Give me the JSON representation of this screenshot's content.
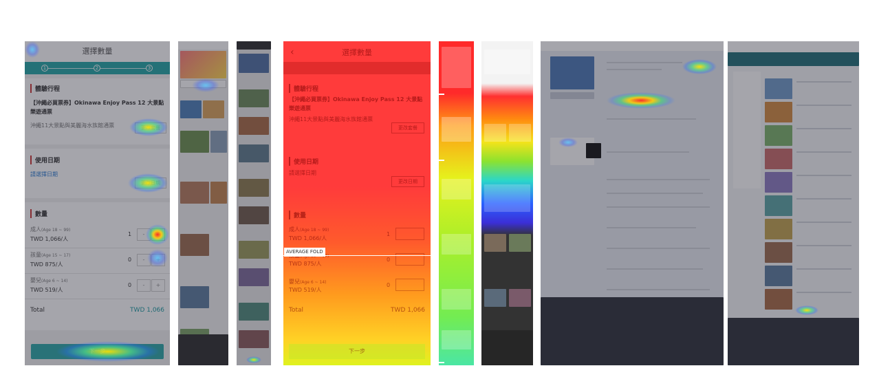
{
  "fold_label": "AVERAGE FOLD",
  "checkout": {
    "header_title": "選擇數量",
    "steps": [
      "1",
      "2",
      "3"
    ],
    "experience": {
      "section_title": "體驗行程",
      "product_name": "【沖繩必買票券】Okinawa Enjoy Pass 12 大景點樂遊通票",
      "plan_name": "沖繩11大景點與美麗海水族館通票",
      "change_button": "更改套餐"
    },
    "date": {
      "section_title": "使用日期",
      "placeholder": "請選擇日期",
      "change_button": "更改日期"
    },
    "quantity": {
      "section_title": "數量",
      "rows": [
        {
          "label": "成人",
          "age": "(Age 18 ~ 99)",
          "price": "TWD 1,066/人",
          "qty": "1",
          "minus": "-",
          "plus": "+"
        },
        {
          "label": "孩童",
          "age": "(Age 15 ~ 17)",
          "price": "TWD 875/人",
          "qty": "0",
          "minus": "-",
          "plus": "+"
        },
        {
          "label": "嬰兒",
          "age": "(Age 6 ~ 14)",
          "price": "TWD 519/人",
          "qty": "0",
          "minus": "-",
          "plus": "+"
        }
      ]
    },
    "total_label": "Total",
    "total_value": "TWD 1,066",
    "next_button": "下一步"
  },
  "colors": {
    "teal": "#22a5a5",
    "accent_red": "#cc3333",
    "heat_red": "#ff3b3b",
    "heat_yellow": "#ffd125"
  }
}
